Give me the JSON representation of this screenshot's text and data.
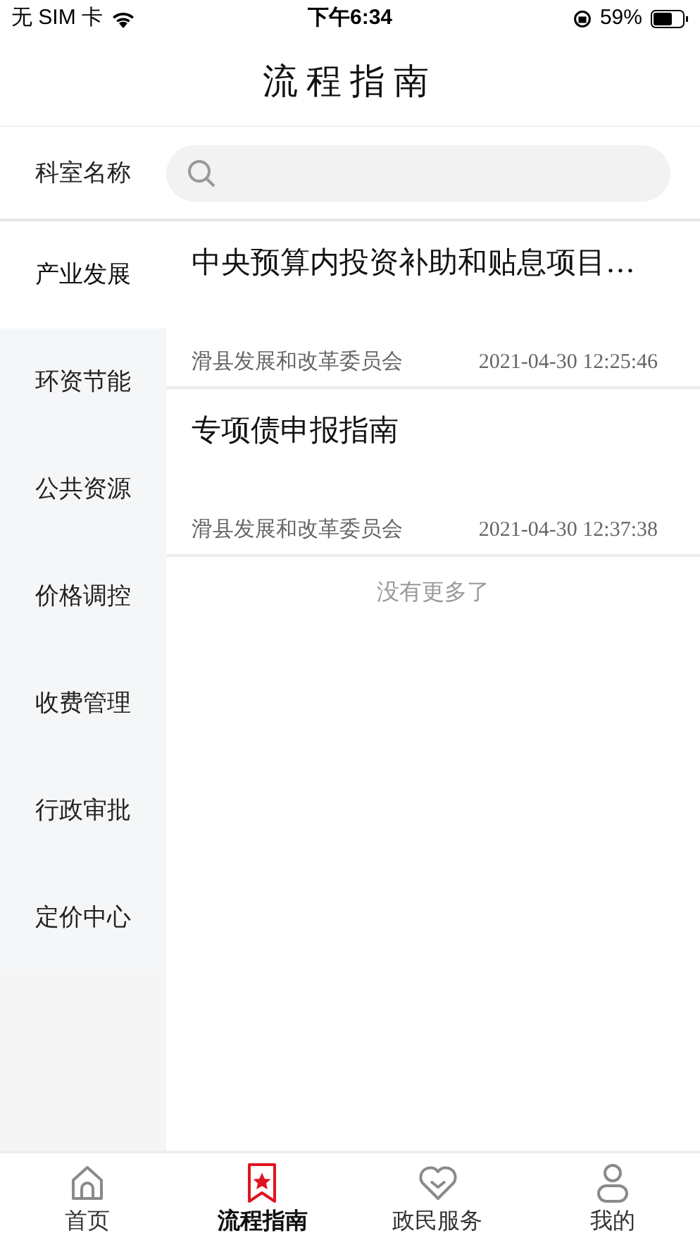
{
  "status_bar": {
    "carrier": "无 SIM 卡",
    "time": "下午6:34",
    "battery": "59%"
  },
  "header": {
    "title": "流程指南"
  },
  "search": {
    "label": "科室名称"
  },
  "sidebar": {
    "items": [
      {
        "label": "产业发展",
        "selected": true
      },
      {
        "label": "环资节能",
        "selected": false
      },
      {
        "label": "公共资源",
        "selected": false
      },
      {
        "label": "价格调控",
        "selected": false
      },
      {
        "label": "收费管理",
        "selected": false
      },
      {
        "label": "行政审批",
        "selected": false
      },
      {
        "label": "定价中心",
        "selected": false
      }
    ]
  },
  "articles": [
    {
      "title": "中央预算内投资补助和贴息项目…",
      "department": "滑县发展和改革委员会",
      "date": "2021-04-30 12:25:46"
    },
    {
      "title": "专项债申报指南",
      "department": "滑县发展和改革委员会",
      "date": "2021-04-30 12:37:38"
    }
  ],
  "list_end": "没有更多了",
  "tab_bar": [
    {
      "label": "首页",
      "selected": false
    },
    {
      "label": "流程指南",
      "selected": true
    },
    {
      "label": "政民服务",
      "selected": false
    },
    {
      "label": "我的",
      "selected": false
    }
  ]
}
